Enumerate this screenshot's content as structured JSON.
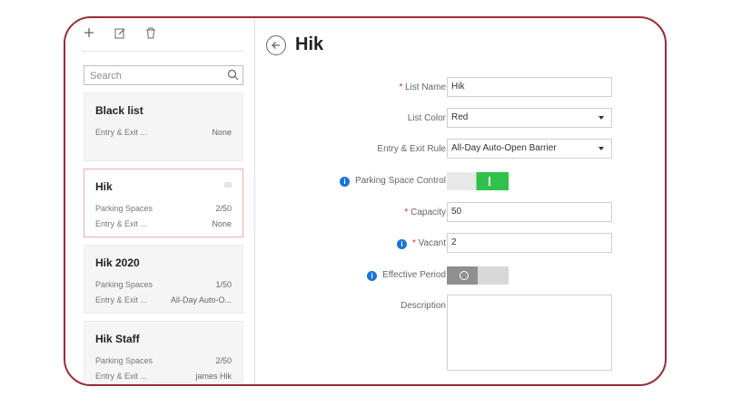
{
  "toolbar": {
    "add_icon": "plus-icon",
    "edit_icon": "edit-icon",
    "delete_icon": "trash-icon"
  },
  "search": {
    "placeholder": "Search"
  },
  "lists": [
    {
      "title": "Black list",
      "rows": [
        {
          "label": "Entry & Exit ...",
          "value": "None"
        }
      ]
    },
    {
      "title": "Hik",
      "selected": true,
      "rows": [
        {
          "label": "Parking Spaces",
          "value": "2/50"
        },
        {
          "label": "Entry & Exit ...",
          "value": "None"
        }
      ]
    },
    {
      "title": "Hik 2020",
      "rows": [
        {
          "label": "Parking Spaces",
          "value": "1/50"
        },
        {
          "label": "Entry & Exit ...",
          "value": "All-Day Auto-O..."
        }
      ]
    },
    {
      "title": "Hik Staff",
      "rows": [
        {
          "label": "Parking Spaces",
          "value": "2/50"
        },
        {
          "label": "Entry & Exit ...",
          "value": "james Hik"
        }
      ]
    }
  ],
  "detail": {
    "title": "Hik",
    "list_name": {
      "label": "List Name",
      "value": "Hik"
    },
    "list_color": {
      "label": "List Color",
      "value": "Red"
    },
    "rule": {
      "label": "Entry & Exit Rule",
      "value": "All-Day Auto-Open Barrier"
    },
    "parking_control": {
      "label": "Parking Space Control",
      "enabled": true
    },
    "capacity": {
      "label": "Capacity",
      "value": "50"
    },
    "vacant": {
      "label": "Vacant",
      "value": "2"
    },
    "effective_period": {
      "label": "Effective Period",
      "enabled": false
    },
    "description": {
      "label": "Description",
      "value": ""
    }
  },
  "colors": {
    "frame": "#9a2a35",
    "toggle_on": "#2fc24a",
    "info": "#1a73d9",
    "required": "#e0242e"
  }
}
